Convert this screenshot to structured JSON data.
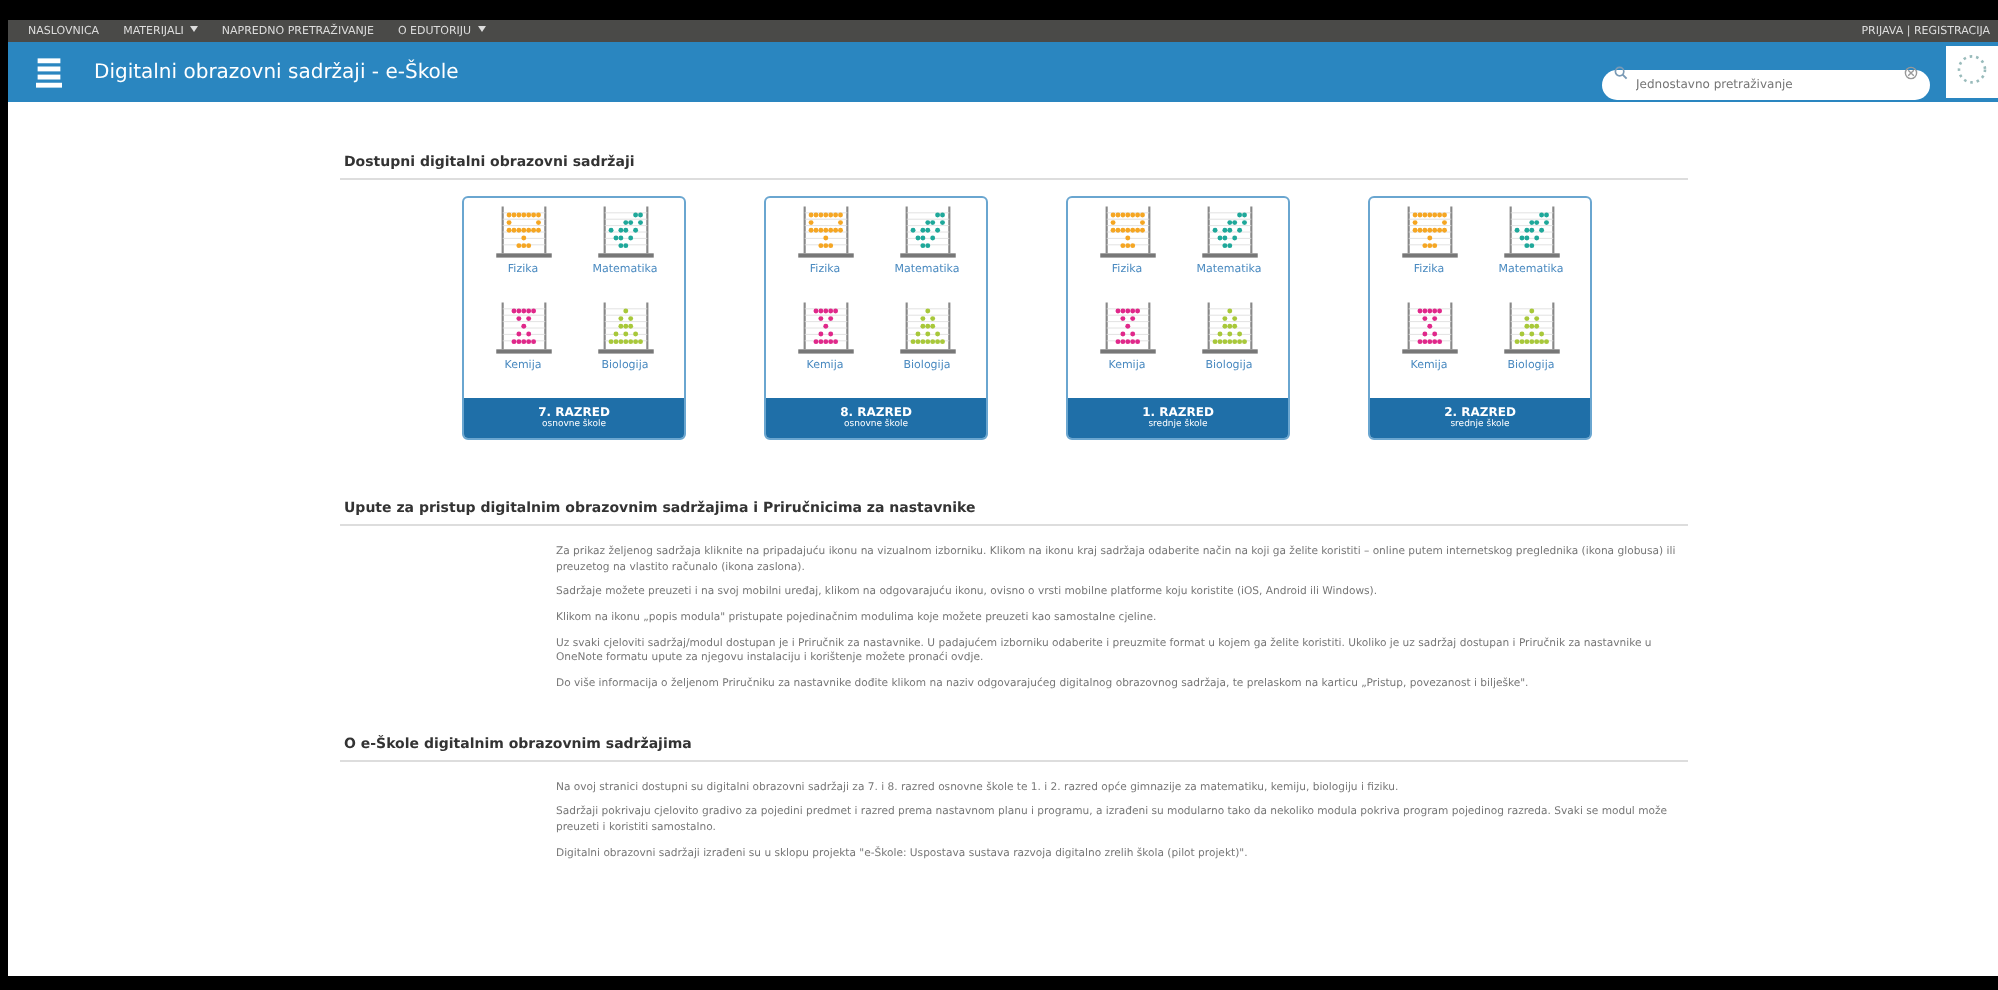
{
  "nav": {
    "items": [
      {
        "label": "NASLOVNICA",
        "dropdown": false
      },
      {
        "label": "MATERIJALI",
        "dropdown": true
      },
      {
        "label": "NAPREDNO PRETRAŽIVANJE",
        "dropdown": false
      },
      {
        "label": "O EDUTORIJU",
        "dropdown": true
      }
    ],
    "auth": "PRIJAVA | REGISTRACIJA"
  },
  "header": {
    "title": "Digitalni obrazovni sadržaji - e-Škole",
    "search": {
      "placeholder": "Jednostavno pretraživanje"
    }
  },
  "sections": [
    {
      "heading": "Dostupni digitalni obrazovni sadržaji",
      "kind": "cards",
      "cards": [
        {
          "grade": "7. RAZRED",
          "school": "osnovne škole",
          "subjects": [
            {
              "name": "Fizika",
              "color": "#f5a623"
            },
            {
              "name": "Matematika",
              "color": "#1fa89a"
            },
            {
              "name": "Kemija",
              "color": "#e0288a"
            },
            {
              "name": "Biologija",
              "color": "#a8c83a"
            }
          ]
        },
        {
          "grade": "8. RAZRED",
          "school": "osnovne škole",
          "subjects": [
            {
              "name": "Fizika",
              "color": "#f5a623"
            },
            {
              "name": "Matematika",
              "color": "#1fa89a"
            },
            {
              "name": "Kemija",
              "color": "#e0288a"
            },
            {
              "name": "Biologija",
              "color": "#a8c83a"
            }
          ]
        },
        {
          "grade": "1. RAZRED",
          "school": "srednje škole",
          "subjects": [
            {
              "name": "Fizika",
              "color": "#f5a623"
            },
            {
              "name": "Matematika",
              "color": "#1fa89a"
            },
            {
              "name": "Kemija",
              "color": "#e0288a"
            },
            {
              "name": "Biologija",
              "color": "#a8c83a"
            }
          ]
        },
        {
          "grade": "2. RAZRED",
          "school": "srednje škole",
          "subjects": [
            {
              "name": "Fizika",
              "color": "#f5a623"
            },
            {
              "name": "Matematika",
              "color": "#1fa89a"
            },
            {
              "name": "Kemija",
              "color": "#e0288a"
            },
            {
              "name": "Biologija",
              "color": "#a8c83a"
            }
          ]
        }
      ]
    },
    {
      "heading": "Upute za pristup digitalnim obrazovnim sadržajima i Priručnicima za nastavnike",
      "kind": "text",
      "paragraphs": [
        "Za prikaz željenog sadržaja kliknite na pripadajuću ikonu na vizualnom izborniku. Klikom na ikonu kraj sadržaja odaberite način na koji ga želite koristiti – online putem internetskog preglednika (ikona globusa) ili preuzetog na vlastito računalo (ikona zaslona).",
        "Sadržaje možete preuzeti i na svoj mobilni uređaj, klikom na odgovarajuću ikonu, ovisno o vrsti mobilne platforme koju koristite (iOS, Android ili Windows).",
        "Klikom na ikonu „popis modula\" pristupate pojedinačnim modulima koje možete preuzeti kao samostalne cjeline.",
        "Uz svaki cjeloviti sadržaj/modul dostupan je i Priručnik za nastavnike. U padajućem izborniku odaberite i preuzmite format u kojem ga želite koristiti. Ukoliko je uz sadržaj dostupan i Priručnik za nastavnike u OneNote formatu upute za njegovu instalaciju i korištenje možete pronaći ovdje.",
        "Do više informacija o željenom Priručniku za nastavnike dođite klikom na naziv odgovarajućeg digitalnog obrazovnog sadržaja, te prelaskom na karticu „Pristup, povezanost i bilješke\"."
      ]
    },
    {
      "heading": "O e-Škole digitalnim obrazovnim sadržajima",
      "kind": "text",
      "paragraphs": [
        "Na ovoj stranici dostupni su digitalni obrazovni sadržaji za 7. i 8. razred osnovne škole te 1. i 2. razred opće gimnazije za matematiku, kemiju, biologiju i fiziku.",
        "Sadržaji pokrivaju cjelovito gradivo za pojedini predmet i razred prema nastavnom planu i programu, a izrađeni su modularno tako da nekoliko modula pokriva program pojedinog razreda. Svaki se modul može preuzeti i koristiti samostalno.",
        "Digitalni obrazovni sadržaji izrađeni su u sklopu projekta \"e-Škole: Uspostava sustava razvoja digitalno zrelih škola (pilot projekt)\"."
      ]
    }
  ]
}
